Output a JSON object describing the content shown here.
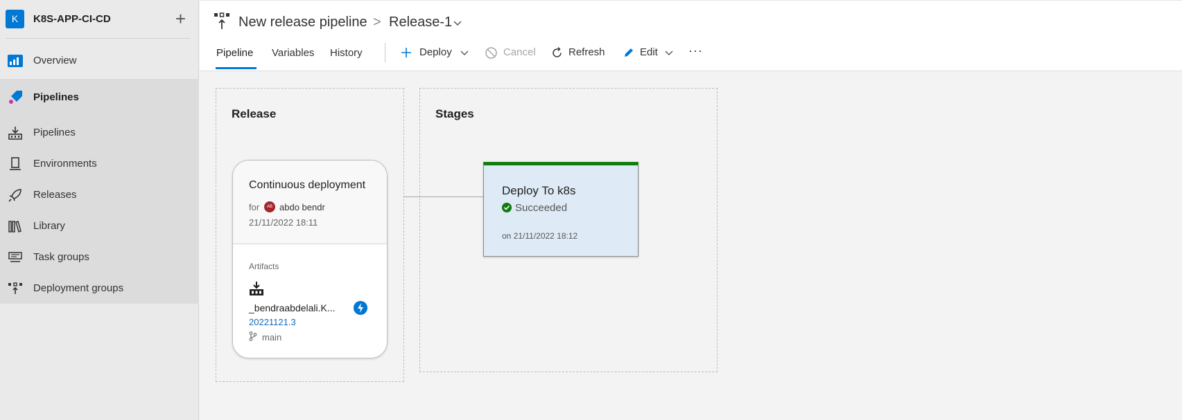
{
  "project": {
    "initial": "K",
    "name": "K8S-APP-CI-CD",
    "add_glyph": "+"
  },
  "sidebar": {
    "items": [
      {
        "label": "Overview",
        "icon": "overview-icon"
      },
      {
        "label": "Pipelines",
        "icon": "pipelines-section-icon"
      },
      {
        "label": "Pipelines",
        "icon": "pipelines-icon"
      },
      {
        "label": "Environments",
        "icon": "environments-icon"
      },
      {
        "label": "Releases",
        "icon": "releases-icon"
      },
      {
        "label": "Library",
        "icon": "library-icon"
      },
      {
        "label": "Task groups",
        "icon": "task-groups-icon"
      },
      {
        "label": "Deployment groups",
        "icon": "deployment-groups-icon"
      }
    ]
  },
  "header": {
    "pipeline_name": "New release pipeline",
    "separator": ">",
    "release_name": "Release-1",
    "tabs": [
      {
        "label": "Pipeline"
      },
      {
        "label": "Variables"
      },
      {
        "label": "History"
      }
    ],
    "toolbar": {
      "deploy": "Deploy",
      "cancel": "Cancel",
      "refresh": "Refresh",
      "edit": "Edit",
      "more": "···"
    }
  },
  "release_panel": {
    "title": "Release",
    "trigger": "Continuous deployment",
    "for_label": "for",
    "user_initials": "AB",
    "user": "abdo bendr",
    "date": "21/11/2022 18:11",
    "artifacts_label": "Artifacts",
    "artifact_name": "_bendraabdelali.K...",
    "build": "20221121.3",
    "branch": "main"
  },
  "stages_panel": {
    "title": "Stages",
    "stage_name": "Deploy To k8s",
    "status": "Succeeded",
    "date": "on 21/11/2022 18:12"
  },
  "colors": {
    "accent": "#0078d4",
    "success": "#107c10",
    "stage_bg": "#deebf7"
  }
}
